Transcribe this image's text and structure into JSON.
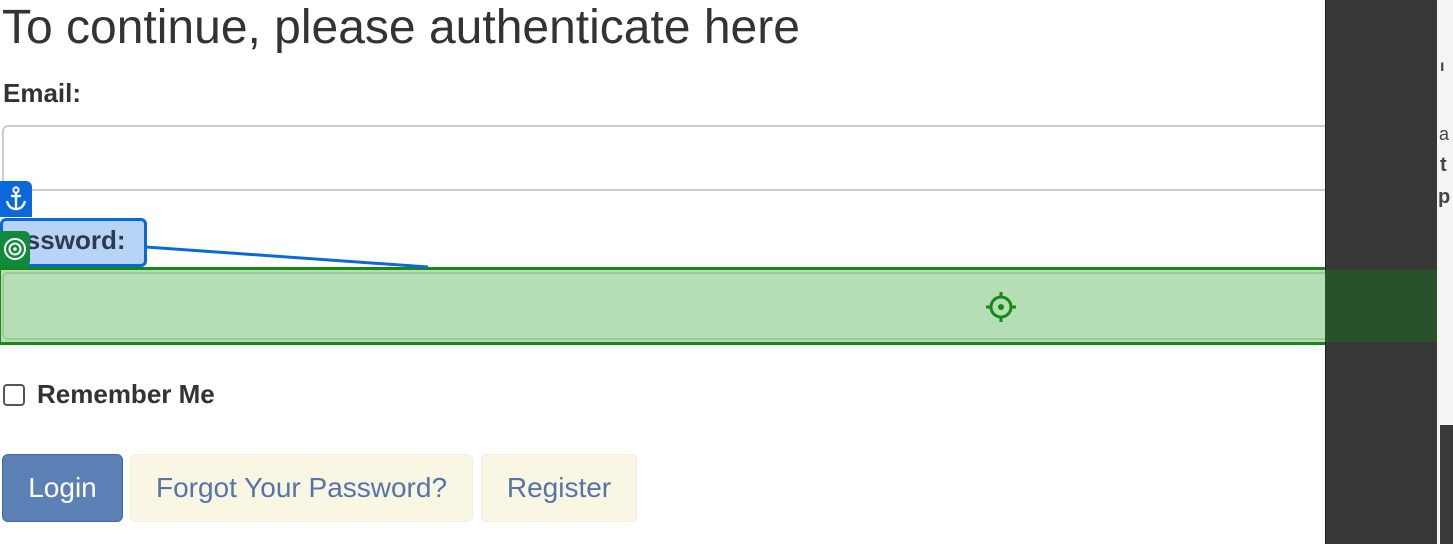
{
  "page": {
    "title": "To continue, please authenticate here"
  },
  "form": {
    "email_label": "Email:",
    "email_value": "",
    "password_label": "Password:",
    "password_value": "",
    "remember_label": "Remember Me",
    "remember_checked": false
  },
  "buttons": {
    "login": "Login",
    "forgot_password": "Forgot Your Password?",
    "register": "Register"
  },
  "annotations": {
    "anchor_icon": "anchor-icon",
    "target_icon": "target-icon",
    "crosshair_icon": "crosshair-icon",
    "anchor_color": "#0b68d8",
    "target_color": "#148a14"
  }
}
